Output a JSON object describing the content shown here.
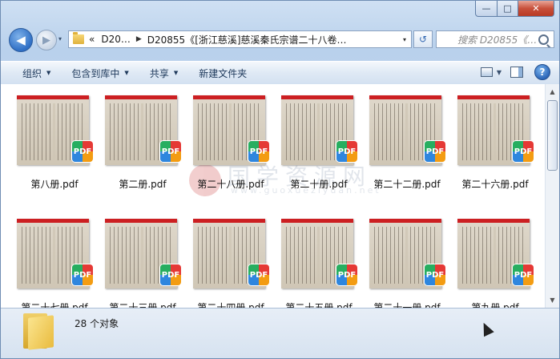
{
  "window": {
    "caption_buttons": {
      "minimize": "—",
      "maximize": "□",
      "close": "✕"
    }
  },
  "nav": {
    "back_glyph": "◀",
    "forward_glyph": "▶",
    "dropdown_glyph": "▾",
    "breadcrumb": [
      "«",
      "D20…",
      "D20855《[浙江慈溪]慈溪秦氏宗谱二十八卷…"
    ],
    "refresh_glyph": "↺",
    "search_placeholder": "搜索 D20855《…"
  },
  "toolbar": {
    "organize": "组织",
    "include_in_library": "包含到库中",
    "share": "共享",
    "new_folder": "新建文件夹"
  },
  "files": [
    {
      "name": "第八册.pdf"
    },
    {
      "name": "第二册.pdf"
    },
    {
      "name": "第二十八册.pdf"
    },
    {
      "name": "第二十册.pdf"
    },
    {
      "name": "第二十二册.pdf"
    },
    {
      "name": "第二十六册.pdf"
    },
    {
      "name": "第二十七册.pdf"
    },
    {
      "name": "第二十三册.pdf"
    },
    {
      "name": "第二十四册.pdf"
    },
    {
      "name": "第二十五册.pdf"
    },
    {
      "name": "第二十一册.pdf"
    },
    {
      "name": "第九册.pdf"
    }
  ],
  "pdf_badge_text": "PDF",
  "thumb_header_text": "PDF",
  "watermark": {
    "title": "国学资源网",
    "url": "www.guoxueziyuan.net"
  },
  "status": {
    "item_count": "28 个对象"
  },
  "colors": {
    "accent": "#2f6fc5",
    "pdf_bar": "#cc1f22"
  }
}
